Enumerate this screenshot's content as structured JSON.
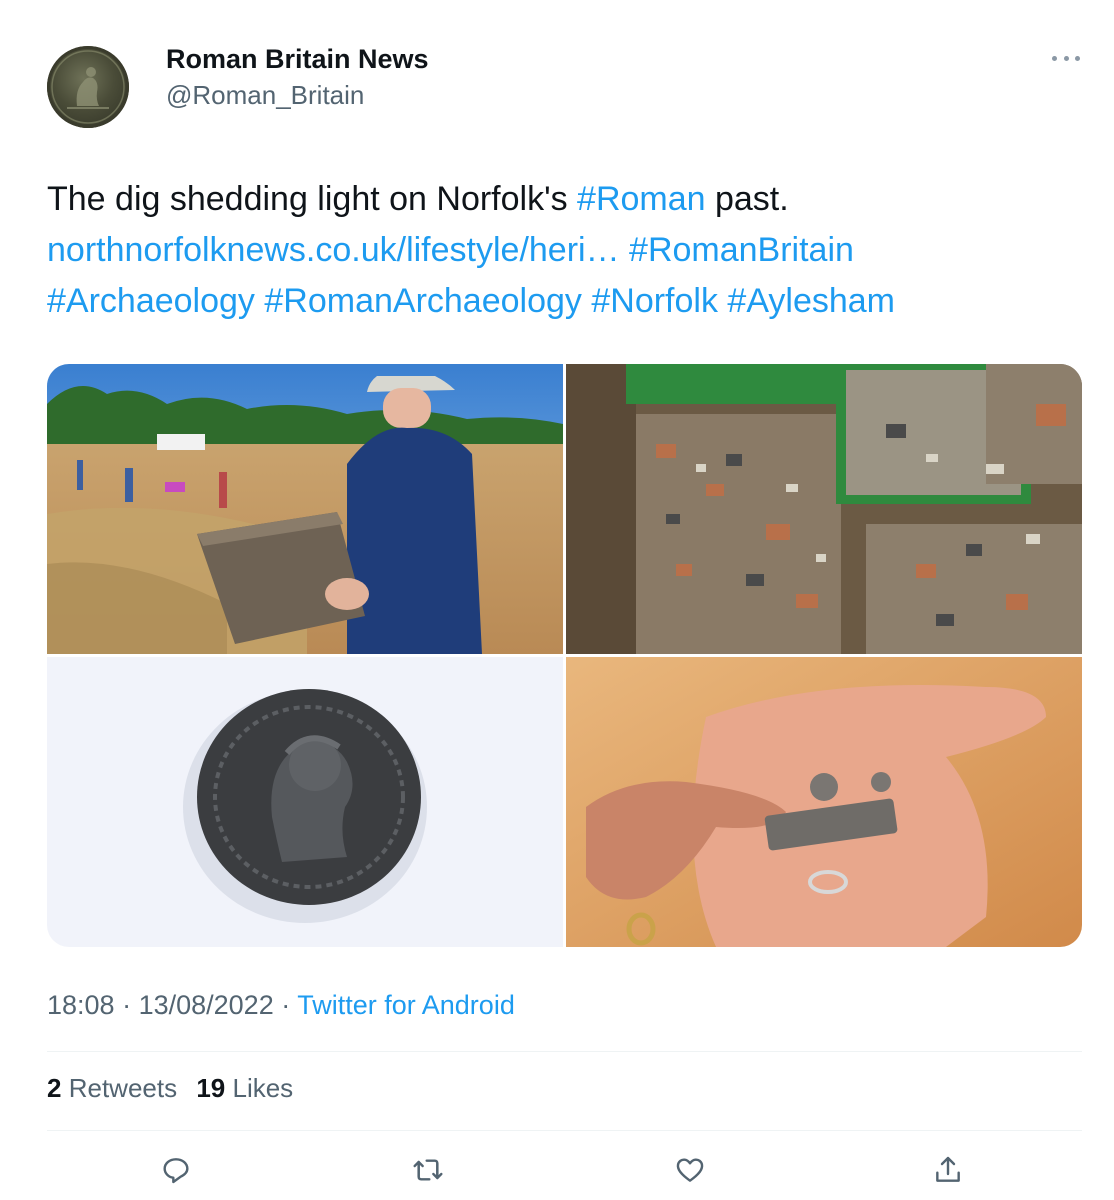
{
  "author": {
    "name": "Roman Britain News",
    "handle": "@Roman_Britain"
  },
  "tweet": {
    "text_plain_1": "The dig shedding light on Norfolk's ",
    "hashtag_roman": "#Roman",
    "text_plain_2": " past.",
    "link": "northnorfolknews.co.uk/lifestyle/heri…",
    "hashtags": [
      "#RomanBritain",
      "#Archaeology",
      "#RomanArchaeology",
      "#Norfolk",
      "#Aylesham"
    ]
  },
  "meta": {
    "time": "18:08",
    "sep1": " · ",
    "date": "13/08/2022",
    "sep2": " · ",
    "source": "Twitter for Android"
  },
  "stats": {
    "retweets_count": "2",
    "retweets_label": "Retweets",
    "likes_count": "19",
    "likes_label": "Likes"
  },
  "icons": {
    "reply": "reply-icon",
    "retweet": "retweet-icon",
    "like": "heart-icon",
    "share": "share-icon",
    "more": "more-icon"
  },
  "colors": {
    "link": "#1d9bf0",
    "secondary_text": "#536471",
    "primary_text": "#0f1419",
    "divider": "#eff3f4"
  }
}
